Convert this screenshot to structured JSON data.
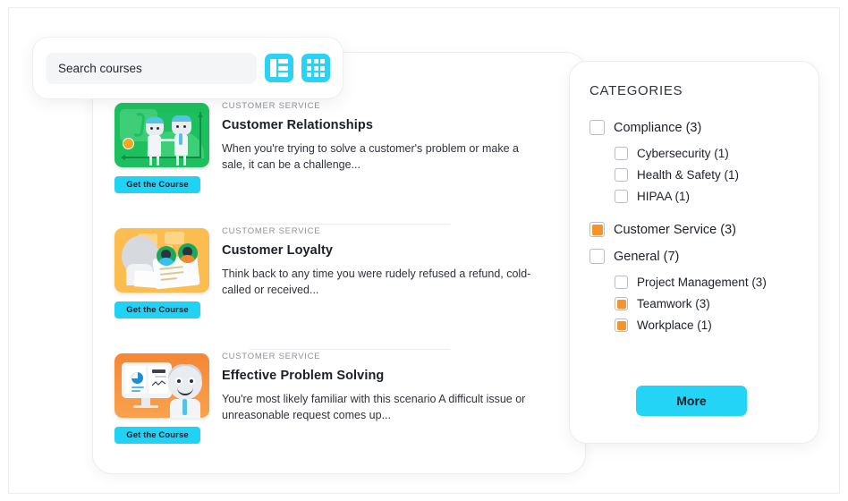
{
  "search": {
    "placeholder": "Search courses",
    "value": "",
    "list_view_icon": "list-view-icon",
    "grid_view_icon": "grid-view-icon"
  },
  "courses": [
    {
      "category": "CUSTOMER SERVICE",
      "title": "Customer Relationships",
      "description": "When you're trying to solve a customer's problem or make a sale, it can be a challenge...",
      "button_label": "Get the Course",
      "thumbnail": "money-handshake-illustration",
      "thumbnail_color": "#1dbf5e"
    },
    {
      "category": "CUSTOMER SERVICE",
      "title": "Customer Loyalty",
      "description": "Think back to any time you were rudely refused a refund, cold-called or received...",
      "button_label": "Get the Course",
      "thumbnail": "letters-feedback-illustration",
      "thumbnail_color": "#fbbd4f"
    },
    {
      "category": "CUSTOMER SERVICE",
      "title": "Effective Problem Solving",
      "description": "You're most likely familiar with this scenario A difficult issue or unreasonable request comes up...",
      "button_label": "Get the Course",
      "thumbnail": "monitor-person-illustration",
      "thumbnail_color": "#f58634"
    }
  ],
  "categories": {
    "heading": "CATEGORIES",
    "items": [
      {
        "label": "Compliance (3)",
        "checked": false,
        "level": 0
      },
      {
        "label": "Cybersecurity (1)",
        "checked": false,
        "level": 1
      },
      {
        "label": "Health & Safety (1)",
        "checked": false,
        "level": 1
      },
      {
        "label": "HIPAA (1)",
        "checked": false,
        "level": 1
      },
      {
        "label": "Customer Service (3)",
        "checked": true,
        "level": 0
      },
      {
        "label": "General (7)",
        "checked": false,
        "level": 0
      },
      {
        "label": "Project Management (3)",
        "checked": false,
        "level": 1
      },
      {
        "label": "Teamwork (3)",
        "checked": true,
        "level": 1
      },
      {
        "label": "Workplace (1)",
        "checked": true,
        "level": 1
      }
    ],
    "more_label": "More"
  },
  "colors": {
    "accent_cyan": "#24d4f7",
    "checkbox_orange": "#f5942b"
  }
}
